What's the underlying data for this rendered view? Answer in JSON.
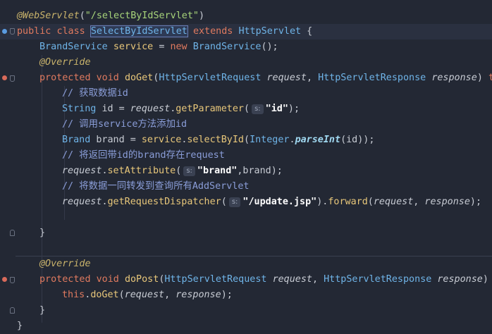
{
  "code": {
    "annotation_servlet": "@WebServlet",
    "annotation_servlet_arg": "\"/selectByIdServlet\"",
    "kw_public": "public",
    "kw_class": "class",
    "class_name": "SelectByIdServlet",
    "kw_extends": "extends",
    "super_class": "HttpServlet",
    "open_brace": " {",
    "field_type": "BrandService",
    "field_name": "service",
    "kw_new": "new",
    "field_ctor": "BrandService",
    "override": "@Override",
    "kw_protected": "protected",
    "kw_void": "void",
    "doget": "doGet",
    "req_type": "HttpServletRequest",
    "req": "request",
    "resp_type": "HttpServletResponse",
    "resp": "response",
    "throws_trunc": "th",
    "cmt1": "// 获取数据id",
    "string_type": "String",
    "var_id": "id",
    "getparam": "getParameter",
    "hint_s": "s:",
    "id_literal": "\"id\"",
    "cmt2": "// 调用service方法添加id",
    "brand_type": "Brand",
    "brand_var": "brand",
    "select_by_id": "selectById",
    "integer": "Integer",
    "parse_int": "parseInt",
    "cmt3": "// 将返回带id的brand存在request",
    "set_attr": "setAttribute",
    "brand_literal": "\"brand\"",
    "cmt4": "// 将数据一同转发到查询所有AddServlet",
    "get_disp": "getRequestDispatcher",
    "jsp_literal": "\"/update.jsp\"",
    "forward": "forward",
    "close_brace": "}",
    "dopost": "doPost",
    "this_kw": "this",
    "resp_trunc": ") t"
  }
}
